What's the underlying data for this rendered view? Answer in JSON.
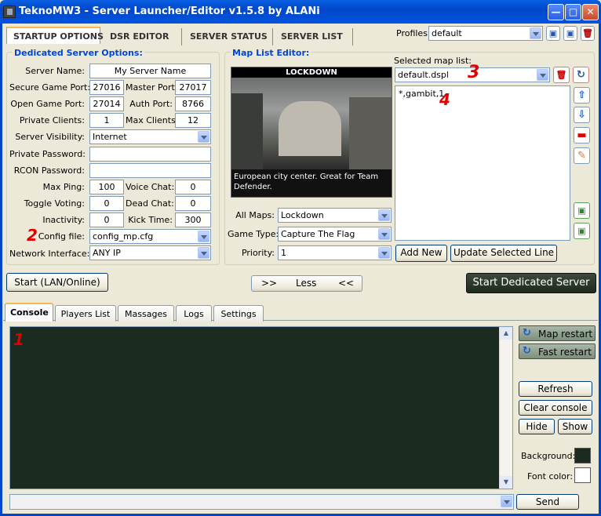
{
  "window": {
    "title": "TeknoMW3 - Server Launcher/Editor v1.5.8 by ALANi"
  },
  "tabs": [
    "STARTUP OPTIONS",
    "DSR EDITOR",
    "SERVER STATUS",
    "SERVER LIST"
  ],
  "profiles": {
    "label": "Profiles:",
    "value": "default"
  },
  "dedicated": {
    "title": "Dedicated Server Options:",
    "server_name_label": "Server Name:",
    "server_name": "My Server Name",
    "secure_port_label": "Secure Game Port:",
    "secure_port": "27016",
    "master_port_label": "Master Port:",
    "master_port": "27017",
    "open_port_label": "Open Game Port:",
    "open_port": "27014",
    "auth_port_label": "Auth Port:",
    "auth_port": "8766",
    "private_clients_label": "Private Clients:",
    "private_clients": "1",
    "max_clients_label": "Max Clients:",
    "max_clients": "12",
    "visibility_label": "Server Visibility:",
    "visibility": "Internet",
    "private_password_label": "Private Password:",
    "private_password": "",
    "rcon_password_label": "RCON Password:",
    "rcon_password": "",
    "max_ping_label": "Max Ping:",
    "max_ping": "100",
    "voice_chat_label": "Voice Chat:",
    "voice_chat": "0",
    "toggle_voting_label": "Toggle Voting:",
    "toggle_voting": "0",
    "dead_chat_label": "Dead Chat:",
    "dead_chat": "0",
    "inactivity_label": "Inactivity:",
    "inactivity": "0",
    "kick_time_label": "Kick Time:",
    "kick_time": "300",
    "config_label": "Config file:",
    "config": "config_mp.cfg",
    "network_label": "Network Interface:",
    "network": "ANY IP"
  },
  "maplist": {
    "title": "Map List Editor:",
    "preview_map_name": "LOCKDOWN",
    "preview_desc": "European city center. Great for Team Defender.",
    "selected_label": "Selected map list:",
    "selected": "default.dspl",
    "entries": [
      "*,gambit,1"
    ],
    "all_maps_label": "All Maps:",
    "all_maps": "Lockdown",
    "game_type_label": "Game Type:",
    "game_type": "Capture The Flag",
    "priority_label": "Priority:",
    "priority": "1",
    "add_new": "Add New",
    "update_line": "Update Selected Line"
  },
  "start_lan": "Start (LAN/Online)",
  "less_toggle": {
    "left": ">>",
    "label": "Less",
    "right": "<<"
  },
  "start_dedicated": "Start Dedicated Server",
  "console_tabs": [
    "Console",
    "Players List",
    "Massages",
    "Logs",
    "Settings"
  ],
  "side": {
    "map_restart": "Map restart",
    "fast_restart": "Fast restart",
    "refresh": "Refresh",
    "clear_console": "Clear console",
    "hide": "Hide",
    "show": "Show",
    "background_label": "Background:",
    "font_color_label": "Font color:",
    "background_color": "#1c2b1f",
    "font_color": "#ffffff"
  },
  "send": "Send",
  "annotations": {
    "one": "1",
    "two": "2",
    "three": "3",
    "four": "4"
  }
}
